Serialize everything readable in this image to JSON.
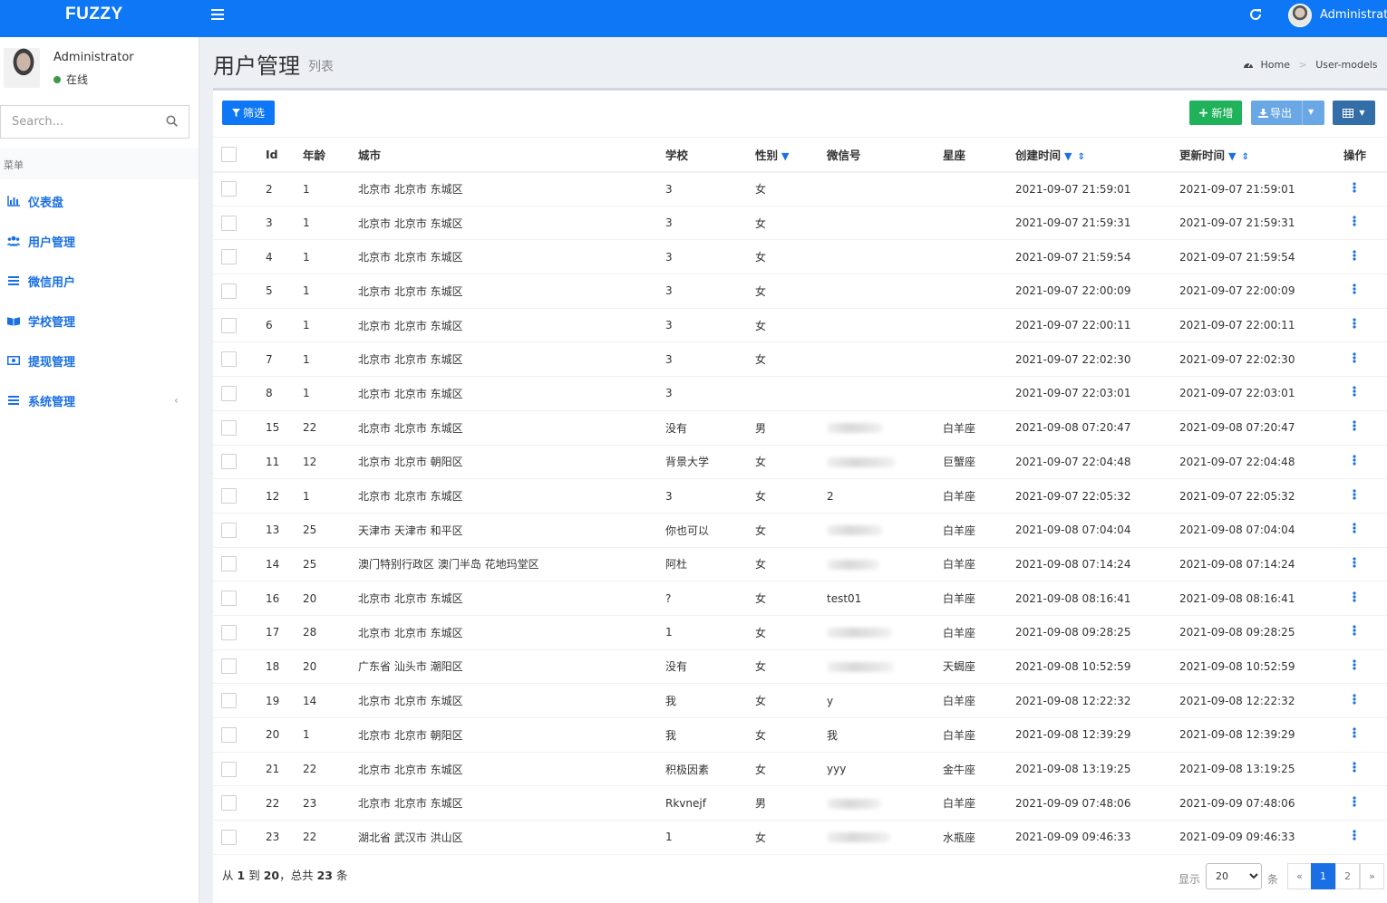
{
  "app": {
    "logo": "FUZZY",
    "user_name": "Administrator"
  },
  "sidebar": {
    "user_name": "Administrator",
    "status": "在线",
    "search_placeholder": "Search...",
    "menu_header": "菜单",
    "items": [
      {
        "label": "仪表盘",
        "icon": "bar-chart-icon"
      },
      {
        "label": "用户管理",
        "icon": "users-icon"
      },
      {
        "label": "微信用户",
        "icon": "list-icon"
      },
      {
        "label": "学校管理",
        "icon": "book-icon"
      },
      {
        "label": "提现管理",
        "icon": "money-icon"
      },
      {
        "label": "系统管理",
        "icon": "list-icon"
      }
    ]
  },
  "header": {
    "title": "用户管理",
    "subtitle": "列表",
    "breadcrumb_home": "Home",
    "breadcrumb_current": "User-models"
  },
  "toolbar": {
    "filter_label": "筛选",
    "add_label": "新增",
    "export_label": "导出"
  },
  "table": {
    "columns": [
      "Id",
      "年龄",
      "城市",
      "学校",
      "性别",
      "微信号",
      "星座",
      "创建时间",
      "更新时间",
      "操作"
    ],
    "rows": [
      {
        "id": "2",
        "age": "1",
        "city": "北京市 北京市 东城区",
        "school": "3",
        "gender": "女",
        "wechat": "",
        "zodiac": "",
        "created": "2021-09-07 21:59:01",
        "updated": "2021-09-07 21:59:01"
      },
      {
        "id": "3",
        "age": "1",
        "city": "北京市 北京市 东城区",
        "school": "3",
        "gender": "女",
        "wechat": "",
        "zodiac": "",
        "created": "2021-09-07 21:59:31",
        "updated": "2021-09-07 21:59:31"
      },
      {
        "id": "4",
        "age": "1",
        "city": "北京市 北京市 东城区",
        "school": "3",
        "gender": "女",
        "wechat": "",
        "zodiac": "",
        "created": "2021-09-07 21:59:54",
        "updated": "2021-09-07 21:59:54"
      },
      {
        "id": "5",
        "age": "1",
        "city": "北京市 北京市 东城区",
        "school": "3",
        "gender": "女",
        "wechat": "",
        "zodiac": "",
        "created": "2021-09-07 22:00:09",
        "updated": "2021-09-07 22:00:09"
      },
      {
        "id": "6",
        "age": "1",
        "city": "北京市 北京市 东城区",
        "school": "3",
        "gender": "女",
        "wechat": "",
        "zodiac": "",
        "created": "2021-09-07 22:00:11",
        "updated": "2021-09-07 22:00:11"
      },
      {
        "id": "7",
        "age": "1",
        "city": "北京市 北京市 东城区",
        "school": "3",
        "gender": "女",
        "wechat": "",
        "zodiac": "",
        "created": "2021-09-07 22:02:30",
        "updated": "2021-09-07 22:02:30"
      },
      {
        "id": "8",
        "age": "1",
        "city": "北京市 北京市 东城区",
        "school": "3",
        "gender": "",
        "wechat": "",
        "zodiac": "",
        "created": "2021-09-07 22:03:01",
        "updated": "2021-09-07 22:03:01"
      },
      {
        "id": "15",
        "age": "22",
        "city": "北京市 北京市 东城区",
        "school": "没有",
        "gender": "男",
        "wechat": "",
        "wechat_blurred": true,
        "zodiac": "白羊座",
        "created": "2021-09-08 07:20:47",
        "updated": "2021-09-08 07:20:47"
      },
      {
        "id": "11",
        "age": "12",
        "city": "北京市 北京市 朝阳区",
        "school": "背景大学",
        "gender": "女",
        "wechat": "",
        "wechat_blurred": true,
        "zodiac": "巨蟹座",
        "created": "2021-09-07 22:04:48",
        "updated": "2021-09-07 22:04:48"
      },
      {
        "id": "12",
        "age": "1",
        "city": "北京市 北京市 东城区",
        "school": "3",
        "gender": "女",
        "wechat": "2",
        "zodiac": "白羊座",
        "created": "2021-09-07 22:05:32",
        "updated": "2021-09-07 22:05:32"
      },
      {
        "id": "13",
        "age": "25",
        "city": "天津市 天津市 和平区",
        "school": "你也可以",
        "gender": "女",
        "wechat": "",
        "wechat_blurred": true,
        "zodiac": "白羊座",
        "created": "2021-09-08 07:04:04",
        "updated": "2021-09-08 07:04:04"
      },
      {
        "id": "14",
        "age": "25",
        "city": "澳门特别行政区 澳门半岛 花地玛堂区",
        "school": "阿杜",
        "gender": "女",
        "wechat": "",
        "wechat_blurred": true,
        "zodiac": "白羊座",
        "created": "2021-09-08 07:14:24",
        "updated": "2021-09-08 07:14:24"
      },
      {
        "id": "16",
        "age": "20",
        "city": "北京市 北京市 东城区",
        "school": "?",
        "gender": "女",
        "wechat": "test01",
        "zodiac": "白羊座",
        "created": "2021-09-08 08:16:41",
        "updated": "2021-09-08 08:16:41"
      },
      {
        "id": "17",
        "age": "28",
        "city": "北京市 北京市 东城区",
        "school": "1",
        "gender": "女",
        "wechat": "",
        "wechat_blurred": true,
        "zodiac": "白羊座",
        "created": "2021-09-08 09:28:25",
        "updated": "2021-09-08 09:28:25"
      },
      {
        "id": "18",
        "age": "20",
        "city": "广东省 汕头市 潮阳区",
        "school": "没有",
        "gender": "女",
        "wechat": "",
        "wechat_blurred": true,
        "zodiac": "天蝎座",
        "created": "2021-09-08 10:52:59",
        "updated": "2021-09-08 10:52:59"
      },
      {
        "id": "19",
        "age": "14",
        "city": "北京市 北京市 东城区",
        "school": "我",
        "gender": "女",
        "wechat": "y",
        "zodiac": "白羊座",
        "created": "2021-09-08 12:22:32",
        "updated": "2021-09-08 12:22:32"
      },
      {
        "id": "20",
        "age": "1",
        "city": "北京市 北京市 朝阳区",
        "school": "我",
        "gender": "女",
        "wechat": "我",
        "zodiac": "白羊座",
        "created": "2021-09-08 12:39:29",
        "updated": "2021-09-08 12:39:29"
      },
      {
        "id": "21",
        "age": "22",
        "city": "北京市 北京市 东城区",
        "school": "积极因素",
        "gender": "女",
        "wechat": "yyy",
        "zodiac": "金牛座",
        "created": "2021-09-08 13:19:25",
        "updated": "2021-09-08 13:19:25"
      },
      {
        "id": "22",
        "age": "23",
        "city": "北京市 北京市 东城区",
        "school": "Rkvnejf",
        "gender": "男",
        "wechat": "",
        "wechat_blurred": true,
        "zodiac": "白羊座",
        "created": "2021-09-09 07:48:06",
        "updated": "2021-09-09 07:48:06"
      },
      {
        "id": "23",
        "age": "22",
        "city": "湖北省 武汉市 洪山区",
        "school": "1",
        "gender": "女",
        "wechat": "",
        "wechat_blurred": true,
        "zodiac": "水瓶座",
        "created": "2021-09-09 09:46:33",
        "updated": "2021-09-09 09:46:33"
      }
    ]
  },
  "pagination": {
    "info_prefix": "从",
    "info_from": "1",
    "info_to_word": "到",
    "info_to": "20",
    "info_total_word": "，总共",
    "info_total": "23",
    "info_suffix": "条",
    "show_label": "显示",
    "page_size": "20",
    "unit": "条",
    "prev": "«",
    "pages": [
      "1",
      "2"
    ],
    "next": "»",
    "current_page": "1"
  },
  "colors": {
    "primary": "#0d77f5",
    "success": "#1fb25a",
    "link": "#1a6fe5"
  }
}
